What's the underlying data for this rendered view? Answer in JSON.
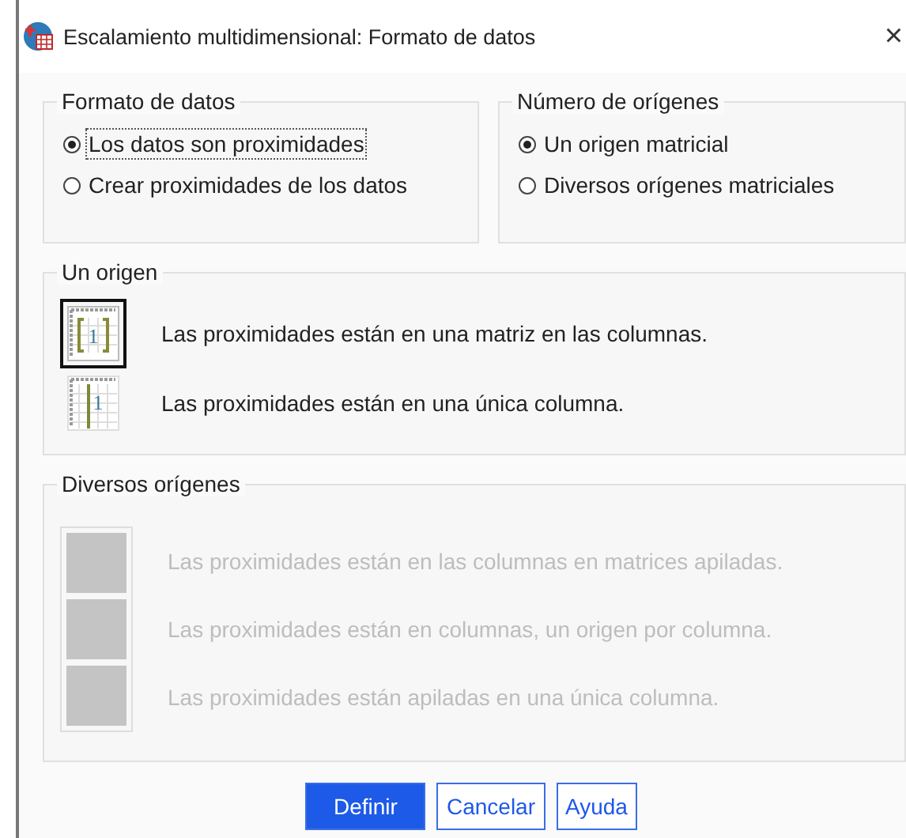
{
  "window": {
    "title": "Escalamiento multidimensional: Formato de datos",
    "close": "×"
  },
  "format_group": {
    "title": "Formato de datos",
    "options": [
      {
        "label": "Los datos son proximidades",
        "selected": true
      },
      {
        "label": "Crear proximidades de los datos",
        "selected": false
      }
    ]
  },
  "sources_group": {
    "title": "Número de orígenes",
    "options": [
      {
        "label": "Un origen matricial",
        "selected": true
      },
      {
        "label": "Diversos orígenes matriciales",
        "selected": false
      }
    ]
  },
  "one_source": {
    "title": "Un origen",
    "options": [
      {
        "kind": "matrix",
        "icon_text": "1",
        "label": "Las proximidades están en una matriz en las columnas.",
        "selected": true,
        "disabled": false
      },
      {
        "kind": "column",
        "icon_text": "1",
        "label": "Las proximidades están en una única columna.",
        "selected": false,
        "disabled": false
      }
    ]
  },
  "multiple_sources": {
    "title": "Diversos orígenes",
    "options": [
      {
        "kind": "blank",
        "label": "Las proximidades están en las columnas en matrices apiladas.",
        "selected": false,
        "disabled": true
      },
      {
        "kind": "blank",
        "label": "Las proximidades están en columnas, un origen por columna.",
        "selected": false,
        "disabled": true
      },
      {
        "kind": "blank",
        "label": "Las proximidades están apiladas en una única columna.",
        "selected": false,
        "disabled": true
      }
    ]
  },
  "buttons": [
    {
      "label": "Definir",
      "default": true
    },
    {
      "label": "Cancelar",
      "default": false
    },
    {
      "label": "Ayuda",
      "default": false
    }
  ]
}
